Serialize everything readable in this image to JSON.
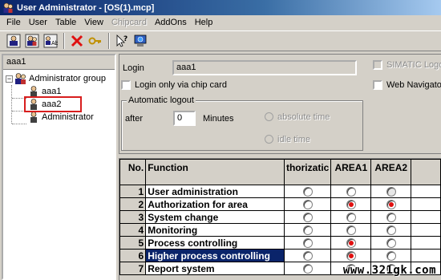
{
  "window": {
    "title": "User Administrator - [OS(1).mcp]"
  },
  "menu": [
    {
      "label": "File",
      "disabled": false
    },
    {
      "label": "User",
      "disabled": false
    },
    {
      "label": "Table",
      "disabled": false
    },
    {
      "label": "View",
      "disabled": false
    },
    {
      "label": "Chipcard",
      "disabled": true
    },
    {
      "label": "AddOns",
      "disabled": false
    },
    {
      "label": "Help",
      "disabled": false
    }
  ],
  "toolbar": {
    "buttons": [
      "new-group-icon",
      "new-user-icon",
      "copy-user-icon",
      "delete-icon",
      "key-icon",
      "help-icon",
      "network-icon"
    ]
  },
  "tree": {
    "header": "aaa1",
    "root": "Administrator group",
    "children": [
      "aaa1",
      "aaa2",
      "Administrator"
    ],
    "selected": "aaa1"
  },
  "settings": {
    "login_label": "Login",
    "login_value": "aaa1",
    "chip_card_label": "Login only via chip card",
    "simatic_logon_label": "SIMATIC Logon",
    "web_navigator_label": "Web Navigator",
    "auto_logout_title": "Automatic logout",
    "after_label": "after",
    "after_value": "0",
    "minutes_label": "Minutes",
    "absolute_time_label": "absolute time",
    "idle_time_label": "idle time"
  },
  "table": {
    "headers": [
      "No.",
      "Function",
      "thorizatic",
      "AREA1",
      "AREA2"
    ],
    "rows": [
      {
        "no": "1",
        "function": "User administration",
        "auth": false,
        "area1": false,
        "area2": false,
        "selected": false
      },
      {
        "no": "2",
        "function": "Authorization for area",
        "auth": false,
        "area1": true,
        "area2": true,
        "selected": false
      },
      {
        "no": "3",
        "function": "System change",
        "auth": false,
        "area1": false,
        "area2": false,
        "selected": false
      },
      {
        "no": "4",
        "function": "Monitoring",
        "auth": false,
        "area1": false,
        "area2": false,
        "selected": false
      },
      {
        "no": "5",
        "function": "Process controlling",
        "auth": false,
        "area1": true,
        "area2": false,
        "selected": false
      },
      {
        "no": "6",
        "function": "Higher process controlling",
        "auth": false,
        "area1": true,
        "area2": false,
        "selected": true
      },
      {
        "no": "7",
        "function": "Report system",
        "auth": false,
        "area1": false,
        "area2": false,
        "selected": false
      }
    ]
  },
  "watermark": "www.321gk.com",
  "colors": {
    "titlebar": "#0a246a",
    "selection": "#0a246a",
    "radio_on": "#e01010",
    "highlight_box": "#d81e1e"
  }
}
